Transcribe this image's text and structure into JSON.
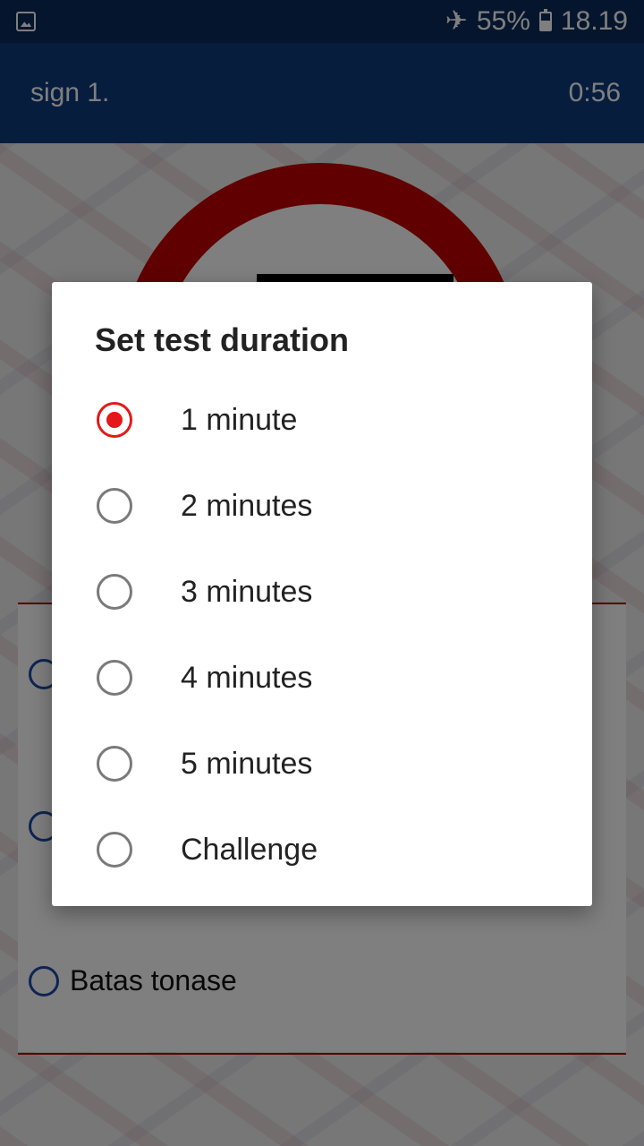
{
  "status_bar": {
    "battery": "55%",
    "time": "18.19",
    "icons": [
      "image-notification-icon",
      "airplane-mode-icon",
      "battery-charging-icon"
    ]
  },
  "app_bar": {
    "title": "sign 1.",
    "timer": "0:56"
  },
  "question": {
    "options": [
      {
        "label": "Batas tonase"
      }
    ]
  },
  "dialog": {
    "title": "Set test duration",
    "selected_index": 0,
    "accent": "#e41818",
    "choices": [
      {
        "label": "1 minute",
        "checked": true
      },
      {
        "label": "2 minutes",
        "checked": false
      },
      {
        "label": "3 minutes",
        "checked": false
      },
      {
        "label": "4 minutes",
        "checked": false
      },
      {
        "label": "5 minutes",
        "checked": false
      },
      {
        "label": "Challenge",
        "checked": false
      }
    ]
  },
  "colors": {
    "status_bar": "#0b2a5a",
    "app_bar": "#0d3a7c",
    "sign_red": "#c00000",
    "option_blue": "#1a4ba8"
  }
}
